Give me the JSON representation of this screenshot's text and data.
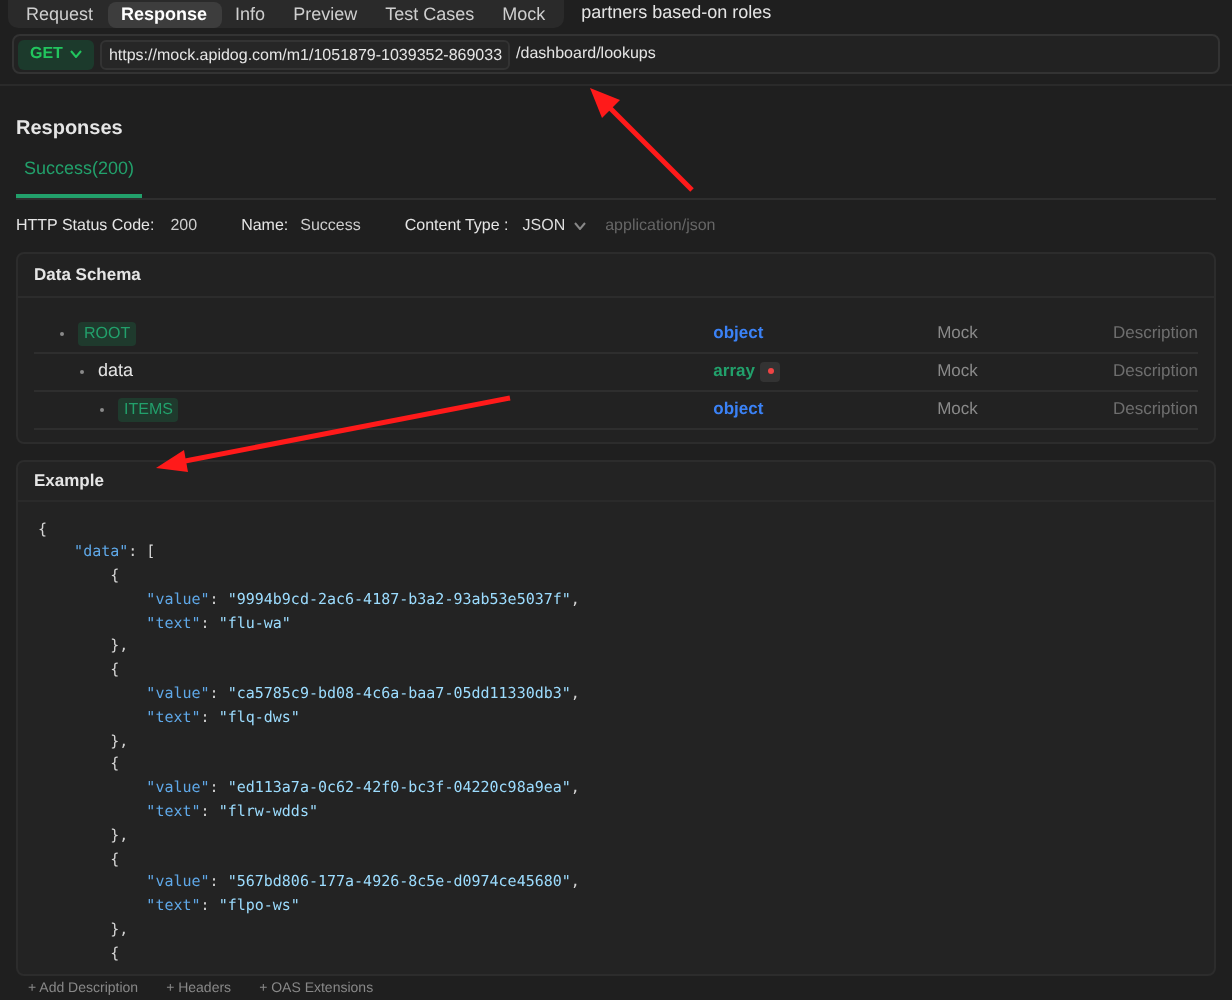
{
  "tabs": [
    {
      "label": "Request",
      "selected": false
    },
    {
      "label": "Response",
      "selected": true
    },
    {
      "label": "Info",
      "selected": false
    },
    {
      "label": "Preview",
      "selected": false
    },
    {
      "label": "Test Cases",
      "selected": false
    },
    {
      "label": "Mock",
      "selected": false
    }
  ],
  "endpoint_title": "partners based-on roles",
  "url_bar": {
    "method": "GET",
    "base_url": "https://mock.apidog.com/m1/1051879-1039352-869033",
    "path": "/dashboard/lookups"
  },
  "responses": {
    "title": "Responses",
    "tabs": [
      {
        "label": "Success(200)",
        "selected": true
      }
    ],
    "fields": {
      "status_label": "HTTP Status Code:",
      "status": "200",
      "name_label": "Name:",
      "name": "Success",
      "content_type_label": "Content Type :",
      "content_type": "JSON",
      "content_type_hint": "application/json"
    }
  },
  "schema": {
    "title": "Data Schema",
    "rows": [
      {
        "name": "ROOT",
        "tagged": true,
        "type": "object",
        "color": "#3b82f6",
        "required": false,
        "mock": "Mock",
        "description": "Description",
        "children": [
          {
            "name": "data",
            "tagged": false,
            "type": "array",
            "color": "#22a06b",
            "required": true,
            "mock": "Mock",
            "description": "Description",
            "children": [
              {
                "name": "ITEMS",
                "tagged": true,
                "type": "object",
                "color": "#3b82f6",
                "required": false,
                "mock": "Mock",
                "description": "Description"
              }
            ]
          }
        ]
      }
    ]
  },
  "example": {
    "title": "Example",
    "lines": [
      [
        {
          "kind": "punct",
          "text": "{"
        }
      ],
      [
        {
          "kind": "key",
          "text": "    \"data\""
        },
        {
          "kind": "punct",
          "text": ": ["
        }
      ],
      [
        {
          "kind": "punct",
          "text": "        {"
        }
      ],
      [
        {
          "kind": "key",
          "text": "            \"value\""
        },
        {
          "kind": "punct",
          "text": ": "
        },
        {
          "kind": "string",
          "text": "\"9994b9cd-2ac6-4187-b3a2-93ab53e5037f\""
        },
        {
          "kind": "punct",
          "text": ","
        }
      ],
      [
        {
          "kind": "key",
          "text": "            \"text\""
        },
        {
          "kind": "punct",
          "text": ": "
        },
        {
          "kind": "string",
          "text": "\"flu-wa\""
        }
      ],
      [
        {
          "kind": "punct",
          "text": "        },"
        }
      ],
      [
        {
          "kind": "punct",
          "text": "        {"
        }
      ],
      [
        {
          "kind": "key",
          "text": "            \"value\""
        },
        {
          "kind": "punct",
          "text": ": "
        },
        {
          "kind": "string",
          "text": "\"ca5785c9-bd08-4c6a-baa7-05dd11330db3\""
        },
        {
          "kind": "punct",
          "text": ","
        }
      ],
      [
        {
          "kind": "key",
          "text": "            \"text\""
        },
        {
          "kind": "punct",
          "text": ": "
        },
        {
          "kind": "string",
          "text": "\"flq-dws\""
        }
      ],
      [
        {
          "kind": "punct",
          "text": "        },"
        }
      ],
      [
        {
          "kind": "punct",
          "text": "        {"
        }
      ],
      [
        {
          "kind": "key",
          "text": "            \"value\""
        },
        {
          "kind": "punct",
          "text": ": "
        },
        {
          "kind": "string",
          "text": "\"ed113a7a-0c62-42f0-bc3f-04220c98a9ea\""
        },
        {
          "kind": "punct",
          "text": ","
        }
      ],
      [
        {
          "kind": "key",
          "text": "            \"text\""
        },
        {
          "kind": "punct",
          "text": ": "
        },
        {
          "kind": "string",
          "text": "\"flrw-wdds\""
        }
      ],
      [
        {
          "kind": "punct",
          "text": "        },"
        }
      ],
      [
        {
          "kind": "punct",
          "text": "        {"
        }
      ],
      [
        {
          "kind": "key",
          "text": "            \"value\""
        },
        {
          "kind": "punct",
          "text": ": "
        },
        {
          "kind": "string",
          "text": "\"567bd806-177a-4926-8c5e-d0974ce45680\""
        },
        {
          "kind": "punct",
          "text": ","
        }
      ],
      [
        {
          "kind": "key",
          "text": "            \"text\""
        },
        {
          "kind": "punct",
          "text": ": "
        },
        {
          "kind": "string",
          "text": "\"flpo-ws\""
        }
      ],
      [
        {
          "kind": "punct",
          "text": "        },"
        }
      ],
      [
        {
          "kind": "punct",
          "text": "        {"
        }
      ]
    ]
  },
  "footer_actions": [
    "+ Add Description",
    "+ Headers",
    "+ OAS Extensions"
  ]
}
